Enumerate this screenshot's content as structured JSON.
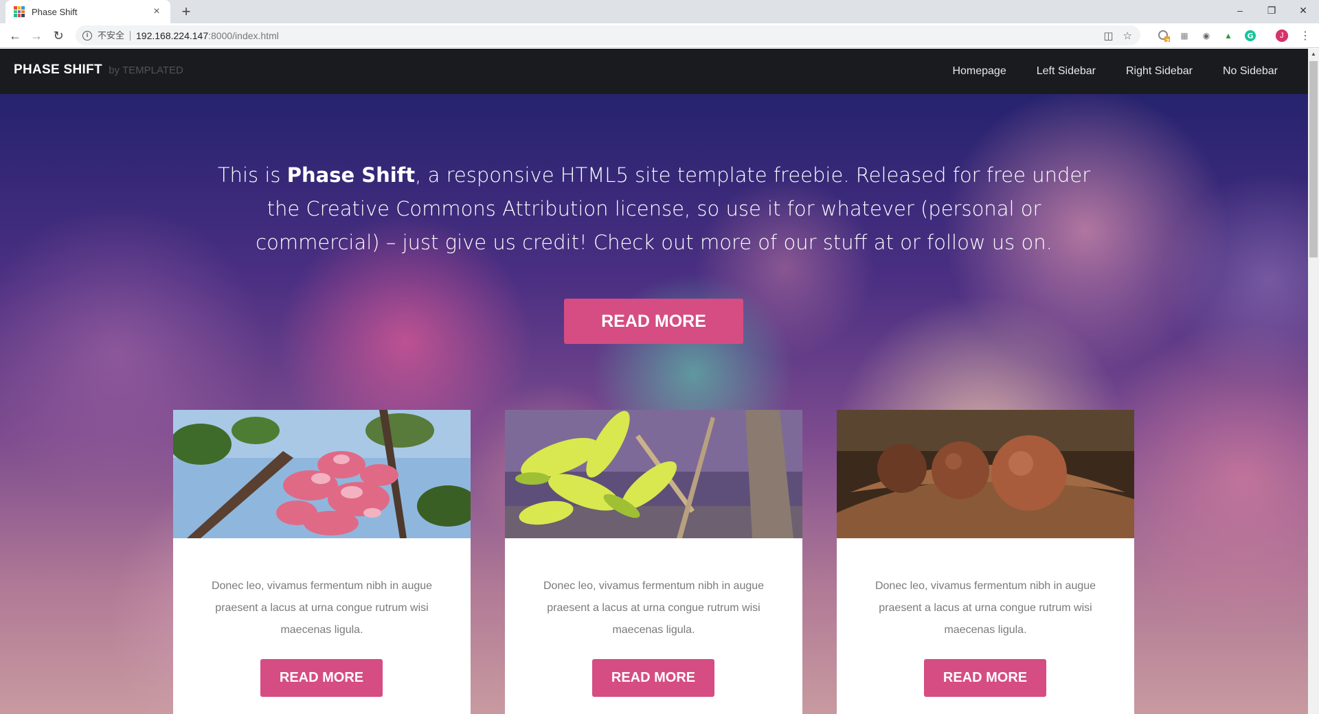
{
  "browser": {
    "tab_title": "Phase Shift",
    "new_tab": "+",
    "close_tab": "×",
    "security_label": "不安全",
    "url_host": "192.168.224.147",
    "url_path": ":8000/index.html",
    "minimize": "–",
    "restore": "❐",
    "close": "✕",
    "avatar_letter": "J",
    "extension_badge": "2"
  },
  "site": {
    "logo": "PHASE SHIFT",
    "logo_by": "by TEMPLATED",
    "nav": [
      "Homepage",
      "Left Sidebar",
      "Right Sidebar",
      "No Sidebar"
    ]
  },
  "hero": {
    "intro_prefix": "This is ",
    "intro_strong": "Phase Shift",
    "intro_suffix": ", a responsive HTML5 site template freebie. Released for free under the Creative Commons Attribution license, so use it for whatever (personal or commercial) – just give us credit! Check out more of our stuff at or follow us on.",
    "button": "READ MORE"
  },
  "cards": [
    {
      "text": "Donec leo, vivamus fermentum nibh in augue praesent a lacus at urna congue rutrum wisi maecenas ligula.",
      "button": "READ MORE",
      "image": "pink-flowers"
    },
    {
      "text": "Donec leo, vivamus fermentum nibh in augue praesent a lacus at urna congue rutrum wisi maecenas ligula.",
      "button": "READ MORE",
      "image": "green-leaves"
    },
    {
      "text": "Donec leo, vivamus fermentum nibh in augue praesent a lacus at urna congue rutrum wisi maecenas ligula.",
      "button": "READ MORE",
      "image": "brown-seeds"
    }
  ],
  "colors": {
    "accent": "#d54d82",
    "header_bg": "#1a1b1e"
  }
}
